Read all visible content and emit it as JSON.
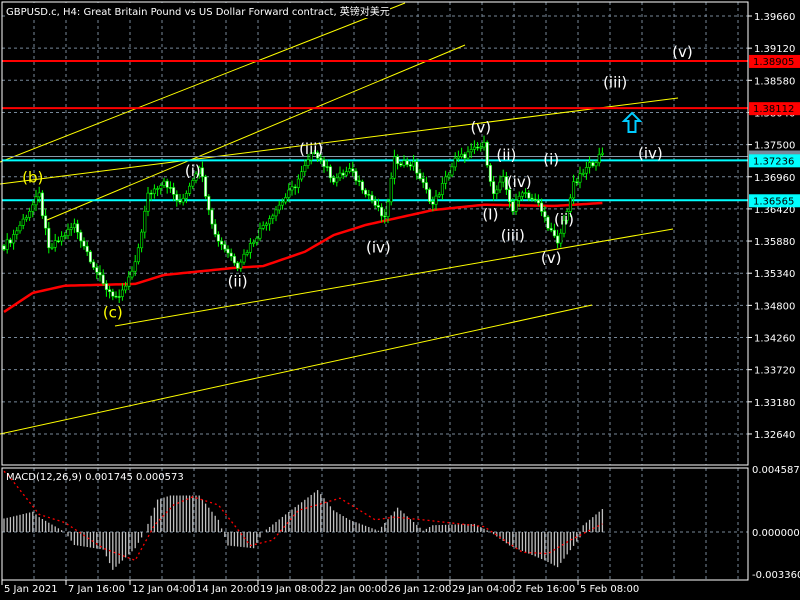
{
  "header": {
    "title": "GBPUSD.c, H4:  Great Britain Pound vs US Dollar Forward contract, 英镑对美元"
  },
  "colors": {
    "background": "#000000",
    "grid": "#778899",
    "candle": "#00ff00",
    "ma": "#ff0000",
    "trendline": "#ffff00",
    "resistance": "#ff0000",
    "support": "#00ffff",
    "macd_hist": "#c0c0c0",
    "macd_signal": "#ff0000"
  },
  "chart_data": [
    {
      "type": "candlestick",
      "symbol": "GBPUSD.c",
      "timeframe": "H4",
      "ylim": [
        1.321,
        1.4
      ],
      "yticks": [
        "1.39660",
        "1.39120",
        "1.38580",
        "1.38040",
        "1.37500",
        "1.36960",
        "1.36420",
        "1.35880",
        "1.35340",
        "1.34800",
        "1.34260",
        "1.33720",
        "1.33180",
        "1.32640"
      ],
      "xticks": [
        "5 Jan 2021",
        "7 Jan 16:00",
        "12 Jan 04:00",
        "14 Jan 20:00",
        "19 Jan 08:00",
        "22 Jan 00:00",
        "26 Jan 12:00",
        "29 Jan 04:00",
        "2 Feb 16:00",
        "5 Feb 08:00"
      ],
      "bar_count": 188,
      "close_path": [
        [
          0,
          1.358
        ],
        [
          2,
          1.359
        ],
        [
          11,
          1.3665
        ],
        [
          14,
          1.3573
        ],
        [
          22,
          1.3615
        ],
        [
          31,
          1.3514
        ],
        [
          36,
          1.3489
        ],
        [
          41,
          1.3548
        ],
        [
          45,
          1.3665
        ],
        [
          50,
          1.3691
        ],
        [
          55,
          1.3649
        ],
        [
          61,
          1.3716
        ],
        [
          66,
          1.3598
        ],
        [
          73,
          1.3548
        ],
        [
          81,
          1.3615
        ],
        [
          91,
          1.3682
        ],
        [
          97,
          1.3741
        ],
        [
          103,
          1.3691
        ],
        [
          108,
          1.3707
        ],
        [
          114,
          1.3665
        ],
        [
          119,
          1.3623
        ],
        [
          122,
          1.3724
        ],
        [
          128,
          1.3716
        ],
        [
          134,
          1.3649
        ],
        [
          141,
          1.3724
        ],
        [
          150,
          1.3749
        ],
        [
          153,
          1.3665
        ],
        [
          156,
          1.3691
        ],
        [
          159,
          1.364
        ],
        [
          162,
          1.3674
        ],
        [
          167,
          1.3649
        ],
        [
          173,
          1.3581
        ],
        [
          178,
          1.3682
        ],
        [
          183,
          1.3716
        ],
        [
          187,
          1.3733
        ]
      ],
      "moving_average": [
        [
          0,
          1.3469
        ],
        [
          9,
          1.3501
        ],
        [
          19,
          1.3513
        ],
        [
          41,
          1.3516
        ],
        [
          50,
          1.3531
        ],
        [
          72,
          1.3543
        ],
        [
          81,
          1.3546
        ],
        [
          94,
          1.357
        ],
        [
          103,
          1.3598
        ],
        [
          113,
          1.3615
        ],
        [
          134,
          1.364
        ],
        [
          150,
          1.3649
        ],
        [
          172,
          1.3647
        ],
        [
          187,
          1.3652
        ]
      ],
      "price_lines": [
        {
          "label": "1.38905",
          "value": 1.38905,
          "kind": "resistance"
        },
        {
          "label": "1.38112",
          "value": 1.38112,
          "kind": "resistance"
        },
        {
          "label": "1.37236",
          "value": 1.37236,
          "kind": "support"
        },
        {
          "label": "1.36565",
          "value": 1.36565,
          "kind": "support"
        }
      ],
      "bid_line": 1.373,
      "wave_labels": [
        {
          "text": "(b)",
          "color": "#ffff00",
          "bar": 9,
          "price": 1.3686
        },
        {
          "text": "(c)",
          "color": "#ffff00",
          "bar": 34,
          "price": 1.346
        },
        {
          "text": "(i)",
          "color": "#ffffff",
          "bar": 59,
          "price": 1.3697
        },
        {
          "text": "(ii)",
          "color": "#ffffff",
          "bar": 73,
          "price": 1.3512
        },
        {
          "text": "(iii)",
          "color": "#ffffff",
          "bar": 96,
          "price": 1.3734
        },
        {
          "text": "(iv)",
          "color": "#ffffff",
          "bar": 117,
          "price": 1.3569
        },
        {
          "text": "(v)",
          "color": "#ffffff",
          "bar": 149,
          "price": 1.377
        },
        {
          "text": "(ii)",
          "color": "#ffffff",
          "bar": 157,
          "price": 1.3724
        },
        {
          "text": "(iv)",
          "color": "#ffffff",
          "bar": 161,
          "price": 1.3679
        },
        {
          "text": "(I)",
          "color": "#ffffff",
          "bar": 152,
          "price": 1.3624
        },
        {
          "text": "(iii)",
          "color": "#ffffff",
          "bar": 159,
          "price": 1.3589
        },
        {
          "text": "(i)",
          "color": "#ffffff",
          "bar": 171,
          "price": 1.3717
        },
        {
          "text": "(ii)",
          "color": "#ffffff",
          "bar": 175,
          "price": 1.3616
        },
        {
          "text": "(v)",
          "color": "#ffffff",
          "bar": 171,
          "price": 1.3551
        },
        {
          "text": "(iii)",
          "color": "#ffffff",
          "bar": 191,
          "price": 1.3846
        },
        {
          "text": "(v)",
          "color": "#ffffff",
          "bar": 212,
          "price": 1.3897
        },
        {
          "text": "(iv)",
          "color": "#ffffff",
          "bar": 202,
          "price": 1.3727
        }
      ]
    },
    {
      "type": "bar",
      "title": "MACD(12,26,9) 0.001745 0.000573",
      "ylim": [
        -0.00336,
        0.004587
      ],
      "yticks": [
        "0.004587",
        "0.000000",
        "-0.003360"
      ],
      "histogram": [
        [
          0,
          0.001
        ],
        [
          2,
          0.0011
        ],
        [
          9,
          0.0015
        ],
        [
          11,
          0.0011
        ],
        [
          19,
          0
        ],
        [
          22,
          -0.00096
        ],
        [
          31,
          -0.0013
        ],
        [
          34,
          -0.0028
        ],
        [
          41,
          -0.0012
        ],
        [
          44,
          0
        ],
        [
          48,
          0.0024
        ],
        [
          52,
          0.0027
        ],
        [
          61,
          0.0027
        ],
        [
          67,
          0.0009
        ],
        [
          70,
          -0.001
        ],
        [
          78,
          -0.0012
        ],
        [
          81,
          0
        ],
        [
          88,
          0.0013
        ],
        [
          98,
          0.0031
        ],
        [
          103,
          0.0016
        ],
        [
          108,
          0.0009
        ],
        [
          117,
          0.0001
        ],
        [
          123,
          0.0018
        ],
        [
          131,
          0.0001
        ],
        [
          134,
          0.0005
        ],
        [
          147,
          0.0006
        ],
        [
          152,
          0
        ],
        [
          158,
          -0.001
        ],
        [
          169,
          -0.0021
        ],
        [
          173,
          -0.0026
        ],
        [
          180,
          -0.0004
        ],
        [
          181,
          0.0005
        ],
        [
          187,
          0.0017
        ]
      ],
      "signal": [
        [
          0,
          0.0045
        ],
        [
          2,
          0.004
        ],
        [
          11,
          0.0013
        ],
        [
          19,
          0.0007
        ],
        [
          31,
          -0.0012
        ],
        [
          41,
          -0.0021
        ],
        [
          47,
          0.0005
        ],
        [
          53,
          0.002
        ],
        [
          59,
          0.0026
        ],
        [
          67,
          0.002
        ],
        [
          77,
          -0.001
        ],
        [
          84,
          -0.0006
        ],
        [
          92,
          0.0016
        ],
        [
          105,
          0.0025
        ],
        [
          116,
          0.0009
        ],
        [
          122,
          0.0011
        ],
        [
          131,
          0.0009
        ],
        [
          150,
          0.0004
        ],
        [
          162,
          -0.0015
        ],
        [
          170,
          -0.0016
        ],
        [
          177,
          -0.0006
        ],
        [
          187,
          0.0006
        ]
      ]
    }
  ]
}
